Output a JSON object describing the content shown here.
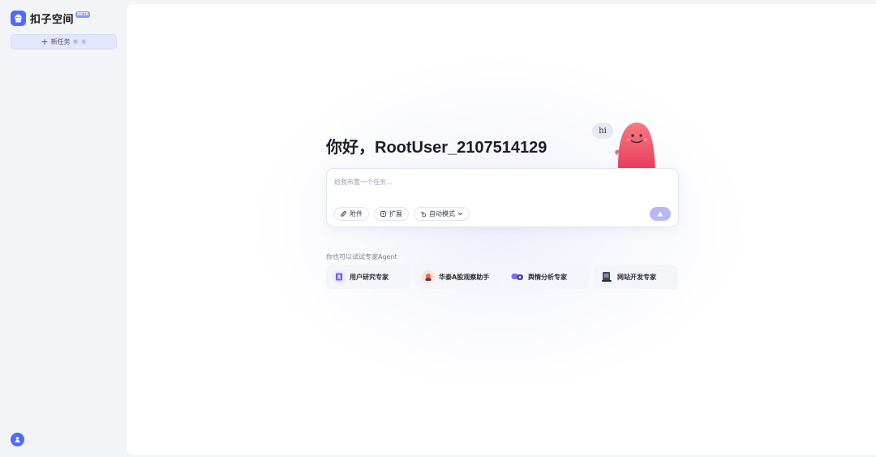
{
  "app": {
    "name": "扣子空间",
    "beta_badge": "BETA"
  },
  "sidebar": {
    "new_task_label": "新任务",
    "shortcut_keys": [
      "⌘",
      "K"
    ]
  },
  "main": {
    "greeting": "你好，RootUser_2107514129",
    "mascot_bubble": "hi",
    "task_input": {
      "placeholder": "给我布置一个任务...",
      "value": ""
    },
    "tools": {
      "attach_label": "附件",
      "extend_label": "扩展",
      "mode_label": "自动模式"
    },
    "try_label": "你也可以试试专家Agent",
    "agents": [
      {
        "label": "用户研究专家",
        "icon": "user-research-icon",
        "color": "#6b5cff"
      },
      {
        "label": "华泰A股观察助手",
        "icon": "stock-observer-icon",
        "color": "#e0714a"
      },
      {
        "label": "舆情分析专家",
        "icon": "sentiment-analysis-icon",
        "color": "#5b6cff"
      },
      {
        "label": "网站开发专家",
        "icon": "web-dev-icon",
        "color": "#3b4660"
      }
    ]
  },
  "colors": {
    "accent": "#4d6bfe",
    "send_button": "#b7b9f2",
    "mascot": "#f0566a"
  }
}
